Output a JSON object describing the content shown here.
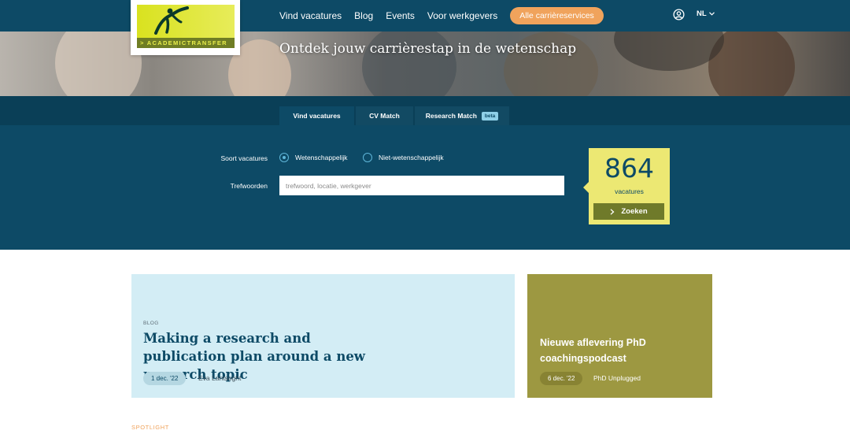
{
  "brand": {
    "logo_text": "ACADEMICTRANSFER"
  },
  "nav": {
    "items": [
      "Vind vacatures",
      "Blog",
      "Events",
      "Voor werkgevers"
    ],
    "cta_label": "Alle carrièreservices",
    "user_icon": "user-circle-icon",
    "language": "NL"
  },
  "hero": {
    "title": "Ontdek jouw carrièrestap in de wetenschap"
  },
  "search": {
    "tabs": [
      {
        "label": "Vind vacatures",
        "active": true
      },
      {
        "label": "CV Match",
        "active": false
      },
      {
        "label": "Research Match",
        "badge": "beta",
        "active": false
      }
    ],
    "type_label": "Soort vacatures",
    "type_options": [
      {
        "label": "Wetenschappelijk",
        "selected": true
      },
      {
        "label": "Niet-wetenschappelijk",
        "selected": false
      }
    ],
    "keywords_label": "Trefwoorden",
    "keywords_value": "",
    "keywords_placeholder": "trefwoord, locatie, werkgever",
    "result_count": "864",
    "result_label": "vacatures",
    "submit_label": "Zoeken"
  },
  "cards": {
    "blog": {
      "kicker": "BLOG",
      "title": "Making a research and publication plan around a new research topic",
      "date": "1 dec. '22",
      "author": "Eva Lantsoght"
    },
    "podcast": {
      "title": "Nieuwe aflevering PhD coachingspodcast",
      "date": "6 dec. '22",
      "source": "PhD Unplugged"
    }
  },
  "spotlight_label": "SPOTLIGHT",
  "colors": {
    "primary": "#0d4a66",
    "accent": "#f0a35c",
    "count_box": "#ece873",
    "blog_card": "#d3edf5",
    "podcast_card": "#9d9841"
  }
}
